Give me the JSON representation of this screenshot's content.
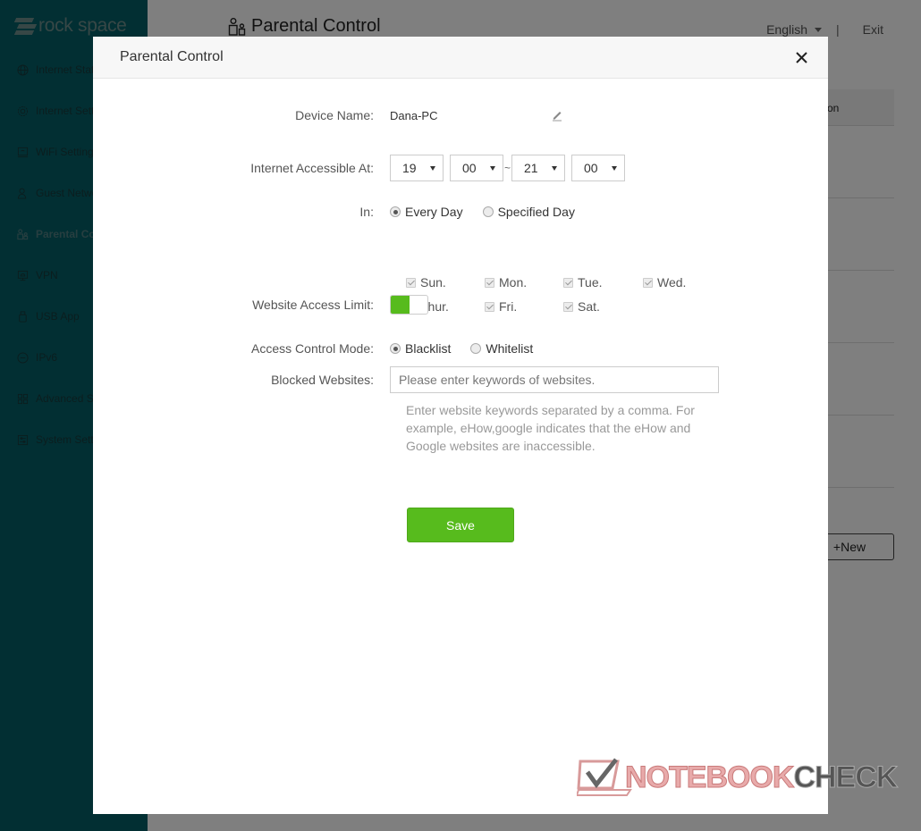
{
  "app": {
    "brand": "rock space",
    "page_title": "Parental Control",
    "language": "English",
    "separator": "|",
    "exit_label": "Exit"
  },
  "sidebar": {
    "items": [
      {
        "label": "Internet Status",
        "icon": "globe-icon",
        "active": false
      },
      {
        "label": "Internet Settings",
        "icon": "internet-settings-icon",
        "active": false
      },
      {
        "label": "WiFi Settings",
        "icon": "wifi-monitor-icon",
        "active": false
      },
      {
        "label": "Guest Network",
        "icon": "guest-user-icon",
        "active": false
      },
      {
        "label": "Parental Control",
        "icon": "parental-control-icon",
        "active": true
      },
      {
        "label": "VPN",
        "icon": "vpn-icon",
        "active": false
      },
      {
        "label": "USB App",
        "icon": "usb-icon",
        "active": false
      },
      {
        "label": "IPv6",
        "icon": "ipv6-icon",
        "active": false
      },
      {
        "label": "Advanced Settings",
        "icon": "grid-icon",
        "active": false
      },
      {
        "label": "System Settings",
        "icon": "system-settings-icon",
        "active": false
      }
    ]
  },
  "background_table": {
    "header_partial": "on",
    "new_button": "+New"
  },
  "modal": {
    "title": "Parental Control",
    "close_label": "×",
    "device_name": {
      "label": "Device Name:",
      "value": "Dana-PC"
    },
    "access_time": {
      "label": "Internet Accessible At:",
      "start_hour": "19",
      "start_minute": "00",
      "range_sep": "~",
      "end_hour": "21",
      "end_minute": "00"
    },
    "days": {
      "label": "In:",
      "mode_options": [
        {
          "label": "Every Day",
          "selected": true
        },
        {
          "label": "Specified Day",
          "selected": false
        }
      ],
      "items": [
        {
          "label": "Sun.",
          "checked": true
        },
        {
          "label": "Mon.",
          "checked": true
        },
        {
          "label": "Tue.",
          "checked": true
        },
        {
          "label": "Wed.",
          "checked": true
        },
        {
          "label": "Thur.",
          "checked": true
        },
        {
          "label": "Fri.",
          "checked": true
        },
        {
          "label": "Sat.",
          "checked": true
        }
      ]
    },
    "website_limit": {
      "label": "Website Access Limit:",
      "enabled": true
    },
    "access_mode": {
      "label": "Access Control Mode:",
      "options": [
        {
          "label": "Blacklist",
          "selected": true
        },
        {
          "label": "Whitelist",
          "selected": false
        }
      ]
    },
    "blocked_websites": {
      "label": "Blocked Websites:",
      "value": "",
      "placeholder": "Please enter keywords of websites."
    },
    "hint": "Enter website keywords separated by a comma. For example, eHow,google indicates that the eHow and Google websites are inaccessible.",
    "save_label": "Save"
  },
  "watermark": {
    "part1": "NOTEBOOK",
    "part2": "CHECK"
  },
  "colors": {
    "sidebar_bg": "#045f66",
    "accent_green": "#57bb1d",
    "overlay": "rgba(0,0,0,0.5)"
  }
}
